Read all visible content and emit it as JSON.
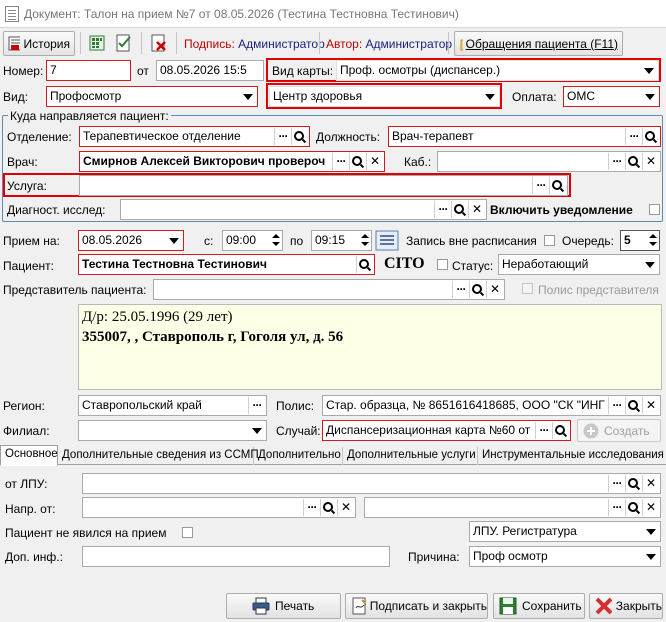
{
  "window": {
    "title": "Документ: Талон на прием №7 от 08.05.2026 (Тестина Тестновна Тестинович)"
  },
  "toolbar": {
    "history_label": "История",
    "signature_key": "Подпись:",
    "signature_value": "Администратор",
    "author_key": "Автор:",
    "author_value": "Администратор",
    "patient_requests_label": "Обращения пациента (F11)"
  },
  "header": {
    "number_label": "Номер:",
    "number_value": "7",
    "from_label": "от",
    "date_value": "08.05.2026 15:5",
    "card_type_label": "Вид карты:",
    "card_type_value": "Проф. осмотры (диспансер.)",
    "kind_label": "Вид:",
    "kind_value": "Профосмотр",
    "center_value": "Центр здоровья",
    "payment_label": "Оплата:",
    "payment_value": "ОМС"
  },
  "referral": {
    "group_title": "Куда направляется пациент:",
    "department_label": "Отделение:",
    "department_value": "Терапевтическое отделение",
    "position_label": "Должность:",
    "position_value": "Врач-терапевт",
    "doctor_label": "Врач:",
    "doctor_value": "Смирнов Алексей Викторович провероч",
    "cabinet_label": "Каб.:",
    "cabinet_value": "",
    "service_label": "Услуга:",
    "service_value": "",
    "diag_label": "Диагност. исслед:",
    "diag_value": "",
    "notify_label": "Включить уведомление"
  },
  "appointment": {
    "visit_label": "Прием на:",
    "visit_date": "08.05.2026",
    "from_label": "с:",
    "from_time": "09:00",
    "to_label": "по",
    "to_time": "09:15",
    "off_schedule_label": "Запись вне расписания",
    "queue_label": "Очередь:",
    "queue_value": "5",
    "patient_label": "Пациент:",
    "patient_value": "Тестина Тестновна Тестинович",
    "cito_label": "CITO",
    "status_label": "Статус:",
    "status_value": "Неработающий",
    "representative_label": "Представитель пациента:",
    "representative_value": "",
    "rep_policy_label": "Полис представителя"
  },
  "patient_info": {
    "line1": "Д/р: 25.05.1996 (29 лет)",
    "line2": "355007, , Ставрополь г, Гоголя ул, д. 56"
  },
  "details": {
    "region_label": "Регион:",
    "region_value": "Ставропольский край",
    "policy_label": "Полис:",
    "policy_value": "Стар. образца, № 8651616418685, ООО \"СК \"ИНГ",
    "branch_label": "Филиал:",
    "branch_value": "",
    "case_label": "Случай:",
    "case_value": "Диспансеризационная карта №60 от",
    "create_label": "Создать"
  },
  "tabs": [
    "Основное",
    "Дополнительные сведения из ССМП",
    "Дополнительно",
    "Дополнительные услуги",
    "Инструментальные исследования"
  ],
  "main_tab": {
    "from_lpu_label": "от ЛПУ:",
    "from_lpu_value": "",
    "sent_from_label": "Напр. от:",
    "sent_from_value": "",
    "sent_from_value2": "",
    "no_show_label": "Пациент не явился на прием",
    "lpu_registry_value": "ЛПУ. Регистратура",
    "extra_info_label": "Доп. инф.:",
    "extra_info_value": "",
    "reason_label": "Причина:",
    "reason_value": "Проф осмотр"
  },
  "footer": {
    "print_label": "Печать",
    "sign_close_label": "Подписать и закрыть",
    "save_label": "Сохранить",
    "close_label": "Закрыть"
  },
  "colors": {
    "required_border": "#d01c1c",
    "highlight": "#e00000",
    "group_border": "#5a8ab8",
    "info_bg": "#ffffe8"
  }
}
